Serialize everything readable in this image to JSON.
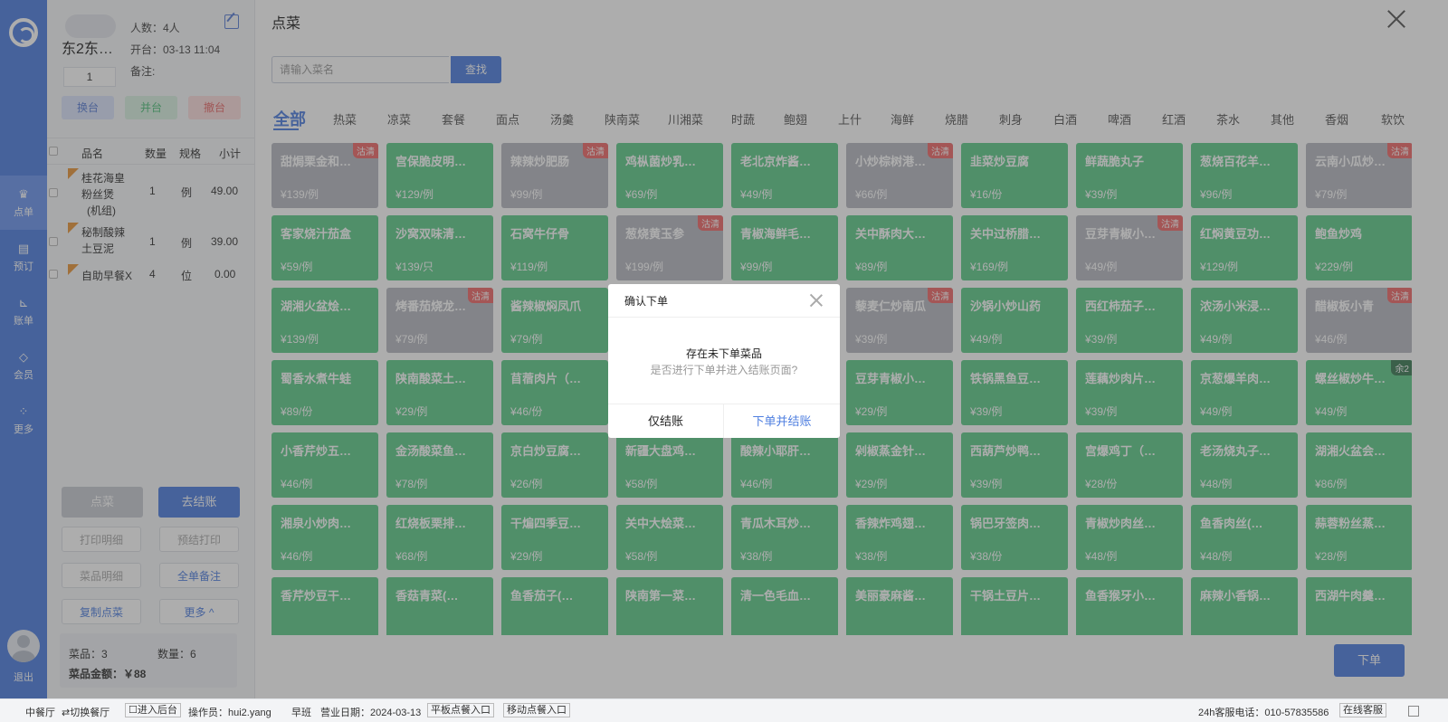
{
  "nav": {
    "items": [
      {
        "label": "点单",
        "icon": "crown-icon"
      },
      {
        "label": "预订",
        "icon": "calendar-icon"
      },
      {
        "label": "账单",
        "icon": "chart-icon"
      },
      {
        "label": "会员",
        "icon": "diamond-icon"
      },
      {
        "label": "更多",
        "icon": "grid-icon"
      }
    ],
    "logout": "退出"
  },
  "order": {
    "table_name": "东2东…",
    "guests": "人数：4人",
    "open_time": "开台：03-13 11:04",
    "remark": "备注:",
    "seat_value": "1",
    "change_table": "换台",
    "merge_table": "并台",
    "cancel_table": "撤台",
    "headers": {
      "name": "品名",
      "qty": "数量",
      "spec": "规格",
      "subtotal": "小计"
    },
    "items": [
      {
        "name": [
          "桂花海皇",
          "粉丝煲",
          "(机组)"
        ],
        "qty": "1",
        "spec": "例",
        "subtotal": "49.00"
      },
      {
        "name": [
          "秘制酸辣",
          "土豆泥"
        ],
        "qty": "1",
        "spec": "例",
        "subtotal": "39.00"
      },
      {
        "name": [
          "自助早餐X"
        ],
        "qty": "4",
        "spec": "位",
        "subtotal": "0.00"
      }
    ],
    "btn_order": "点菜",
    "btn_checkout": "去结账",
    "btn_print_detail": "打印明细",
    "btn_pre_print": "预结打印",
    "btn_dish_detail": "菜品明细",
    "btn_order_note": "全单备注",
    "btn_copy": "复制点菜",
    "btn_more": "更多 ^",
    "summary": {
      "dishes": "菜品：3",
      "count": "数量：6",
      "amount": "菜品金额：￥88"
    }
  },
  "main": {
    "title": "点菜",
    "search_placeholder": "请输入菜名",
    "search_btn": "查找",
    "categories": [
      "全部",
      "热菜",
      "凉菜",
      "套餐",
      "面点",
      "汤羹",
      "陕南菜",
      "川湘菜",
      "时蔬",
      "鲍翅",
      "上什",
      "海鲜",
      "烧腊",
      "刺身",
      "白酒",
      "啤酒",
      "红酒",
      "茶水",
      "其他",
      "香烟",
      "软饮"
    ],
    "submit_btn": "下单",
    "dishes": [
      [
        {
          "name": "甜焗栗金和…",
          "price": "¥139/例",
          "grey": true,
          "tag": "沽清"
        },
        {
          "name": "宫保脆皮明…",
          "price": "¥129/例"
        },
        {
          "name": "辣辣炒肥肠",
          "price": "¥99/例",
          "grey": true,
          "tag": "沽清"
        },
        {
          "name": "鸡枞菌炒乳…",
          "price": "¥69/例"
        },
        {
          "name": "老北京炸酱…",
          "price": "¥49/例"
        },
        {
          "name": "小炒棕树港…",
          "price": "¥66/例",
          "grey": true,
          "tag": "沽清"
        },
        {
          "name": "韭菜炒豆腐",
          "price": "¥16/份"
        },
        {
          "name": "鲜蔬脆丸子",
          "price": "¥39/例"
        },
        {
          "name": "葱烧百花羊…",
          "price": "¥96/例"
        },
        {
          "name": "云南小瓜炒…",
          "price": "¥79/例",
          "grey": true,
          "tag": "沽清"
        }
      ],
      [
        {
          "name": "客家烧汁茄盒",
          "price": "¥59/例"
        },
        {
          "name": "沙窝双味清…",
          "price": "¥139/只"
        },
        {
          "name": "石窝牛仔骨",
          "price": "¥119/例"
        },
        {
          "name": "葱烧黄玉参",
          "price": "¥199/例",
          "grey": true,
          "tag": "沽清"
        },
        {
          "name": "青椒海鲜毛…",
          "price": "¥99/例"
        },
        {
          "name": "关中酥肉大…",
          "price": "¥89/例"
        },
        {
          "name": "关中过桥腊…",
          "price": "¥169/例"
        },
        {
          "name": "豆芽青椒小…",
          "price": "¥49/例",
          "grey": true,
          "tag": "沽清"
        },
        {
          "name": "红焖黄豆功…",
          "price": "¥129/例"
        },
        {
          "name": "鲍鱼炒鸡",
          "price": "¥229/例"
        }
      ],
      [
        {
          "name": "湖湘火盆烩…",
          "price": "¥139/例"
        },
        {
          "name": "烤番茄烧龙…",
          "price": "¥79/例",
          "grey": true,
          "tag": "沽清"
        },
        {
          "name": "酱辣椒焖凤爪",
          "price": "¥79/例"
        },
        {
          "name": "",
          "price": ""
        },
        {
          "name": "",
          "price": ""
        },
        {
          "name": "藜麦仁炒南瓜",
          "price": "¥39/例",
          "grey": true,
          "tag": "沽清"
        },
        {
          "name": "沙锅小炒山药",
          "price": "¥49/例"
        },
        {
          "name": "西红柿茄子…",
          "price": "¥39/例"
        },
        {
          "name": "浓汤小米浸…",
          "price": "¥49/例"
        },
        {
          "name": "醋椒板小青",
          "price": "¥46/例",
          "grey": true,
          "tag": "沽清"
        }
      ],
      [
        {
          "name": "蜀香水煮牛蛙",
          "price": "¥89/份"
        },
        {
          "name": "陕南酸菜土…",
          "price": "¥29/例"
        },
        {
          "name": "苜蓿肉片（…",
          "price": "¥46/份"
        },
        {
          "name": "",
          "price": ""
        },
        {
          "name": "",
          "price": ""
        },
        {
          "name": "豆芽青椒小…",
          "price": "¥29/例"
        },
        {
          "name": "铁锅黑鱼豆…",
          "price": "¥39/例"
        },
        {
          "name": "莲藕炒肉片…",
          "price": "¥39/例"
        },
        {
          "name": "京葱爆羊肉…",
          "price": "¥49/例"
        },
        {
          "name": "螺丝椒炒牛…",
          "price": "¥49/例",
          "tag": "余2",
          "dark": true
        }
      ],
      [
        {
          "name": "小香芹炒五…",
          "price": "¥46/例"
        },
        {
          "name": "金汤酸菜鱼…",
          "price": "¥78/例"
        },
        {
          "name": "京白炒豆腐…",
          "price": "¥26/例"
        },
        {
          "name": "新疆大盘鸡…",
          "price": "¥58/例"
        },
        {
          "name": "酸辣小耶肝…",
          "price": "¥46/例"
        },
        {
          "name": "剁椒蒸金针…",
          "price": "¥29/例"
        },
        {
          "name": "西葫芦炒鸭…",
          "price": "¥39/例"
        },
        {
          "name": "宫爆鸡丁（…",
          "price": "¥28/份"
        },
        {
          "name": "老汤烧丸子…",
          "price": "¥48/例"
        },
        {
          "name": "湖湘火盆会…",
          "price": "¥86/例"
        }
      ],
      [
        {
          "name": "湘泉小炒肉…",
          "price": "¥46/例"
        },
        {
          "name": "红烧板栗排…",
          "price": "¥68/例"
        },
        {
          "name": "干煸四季豆…",
          "price": "¥29/例"
        },
        {
          "name": "关中大烩菜…",
          "price": "¥58/例"
        },
        {
          "name": "青瓜木耳炒…",
          "price": "¥38/例"
        },
        {
          "name": "香辣炸鸡翅…",
          "price": "¥38/例"
        },
        {
          "name": "锅巴牙签肉…",
          "price": "¥38/份"
        },
        {
          "name": "青椒炒肉丝…",
          "price": "¥48/例"
        },
        {
          "name": "鱼香肉丝(…",
          "price": "¥48/例"
        },
        {
          "name": "蒜蓉粉丝蒸…",
          "price": "¥28/例"
        }
      ],
      [
        {
          "name": "香芹炒豆干…",
          "price": ""
        },
        {
          "name": "香菇青菜(…",
          "price": ""
        },
        {
          "name": "鱼香茄子(…",
          "price": ""
        },
        {
          "name": "陕南第一菜…",
          "price": ""
        },
        {
          "name": "清一色毛血…",
          "price": ""
        },
        {
          "name": "美丽豪麻酱…",
          "price": ""
        },
        {
          "name": "干锅土豆片…",
          "price": ""
        },
        {
          "name": "鱼香猴牙小…",
          "price": ""
        },
        {
          "name": "麻辣小香锅…",
          "price": ""
        },
        {
          "name": "西湖牛肉羹…",
          "price": ""
        }
      ]
    ]
  },
  "dialog": {
    "title": "确认下单",
    "message": "存在未下单菜品",
    "sub": "是否进行下单并进入结账页面?",
    "btn_checkout_only": "仅结账",
    "btn_order_checkout": "下单并结账"
  },
  "status_bar": {
    "restaurant": "中餐厅",
    "switch": "⇄切换餐厅",
    "backend": "☐进入后台",
    "operator": "操作员：hui2.yang",
    "shift": "早班",
    "biz_date": "营业日期：2024-03-13",
    "tablet": "平板点餐入口",
    "mobile": "移动点餐入口",
    "hotline": "24h客服电话：010-57835586",
    "online": "在线客服"
  }
}
